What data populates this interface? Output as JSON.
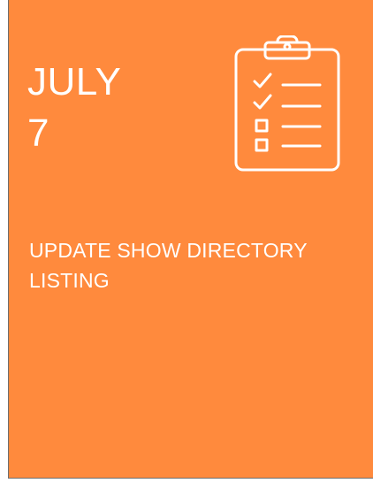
{
  "card": {
    "month": "JULY",
    "day": "7",
    "task": "UPDATE SHOW DIRECTORY LISTING",
    "icon": "clipboard-checklist-icon",
    "background_color": "#ff8a3d",
    "text_color": "#ffffff"
  }
}
